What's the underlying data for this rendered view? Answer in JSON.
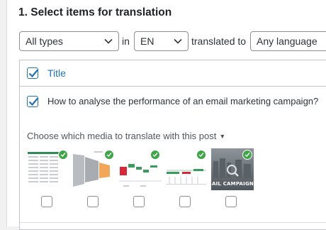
{
  "section": {
    "title": "1. Select items for translation"
  },
  "filters": {
    "type_select": "All types",
    "in_text": "in",
    "language_select": "EN",
    "translated_to_text": "translated to",
    "target_select": "Any language"
  },
  "table": {
    "header_title": "Title",
    "header_checked": true,
    "rows": [
      {
        "title": "How to analyse the performance of an email marketing campaign?",
        "checked": true,
        "media_label": "Choose which media to translate with this post",
        "media": [
          {
            "name": "spreadsheet-thumbnail",
            "checked": false
          },
          {
            "name": "funnel-chart-thumbnail",
            "checked": false
          },
          {
            "name": "waterfall-chart-thumbnail",
            "checked": false
          },
          {
            "name": "bar-chart-thumbnail",
            "checked": false
          },
          {
            "name": "campaign-image-thumbnail",
            "caption": "AIL CAMPAIGN",
            "checked": false
          }
        ]
      }
    ]
  },
  "colors": {
    "accent": "#2271b1",
    "badge": "#3fa548"
  }
}
